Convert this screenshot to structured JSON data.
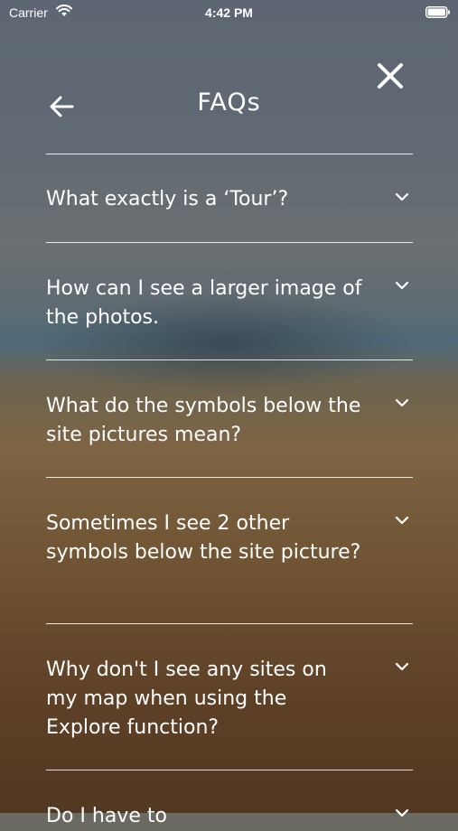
{
  "status_bar": {
    "carrier": "Carrier",
    "time": "4:42 PM",
    "icons": [
      "wifi-icon",
      "battery-icon"
    ]
  },
  "header": {
    "title": "FAQs",
    "back_icon": "arrow-left-icon",
    "close_icon": "close-icon"
  },
  "faqs": [
    {
      "question": "What exactly is a ‘Tour’?"
    },
    {
      "question": "How can I see a larger image of the photos."
    },
    {
      "question": "What do the symbols below the site pictures mean?"
    },
    {
      "question": "Sometimes I see 2 other symbols below the site picture?"
    },
    {
      "question": "Why don't  I see any sites on my map when using the Explore function?"
    },
    {
      "question": "Do I have to"
    }
  ],
  "colors": {
    "text": "#ffffff",
    "divider": "#ffffff"
  }
}
